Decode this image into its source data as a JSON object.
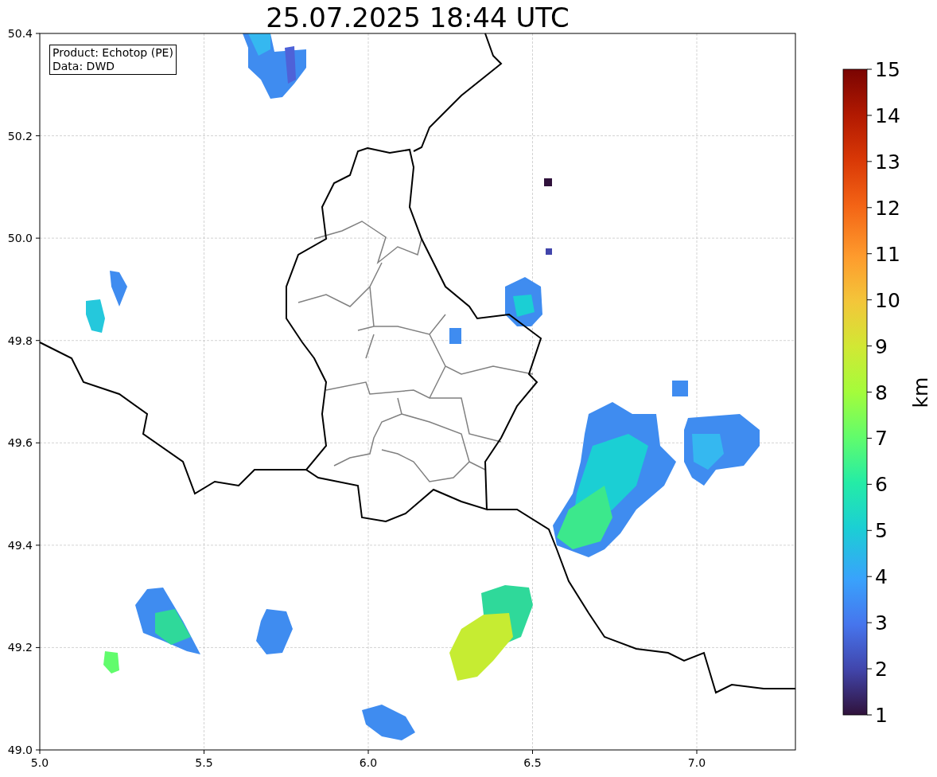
{
  "title": "25.07.2025 18:44 UTC",
  "annotation": [
    "Product: Echotop (PE)",
    "Data: DWD"
  ],
  "x_ticks": [
    "5.0",
    "5.5",
    "6.0",
    "6.5",
    "7.0"
  ],
  "y_ticks": [
    "50.4",
    "50.2",
    "50.0",
    "49.8",
    "49.6",
    "49.4",
    "49.2",
    "49.0"
  ],
  "colorbar": {
    "label": "km",
    "ticks": [
      "15",
      "14",
      "13",
      "12",
      "11",
      "10",
      "9",
      "8",
      "7",
      "6",
      "5",
      "4",
      "3",
      "2",
      "1"
    ]
  }
}
